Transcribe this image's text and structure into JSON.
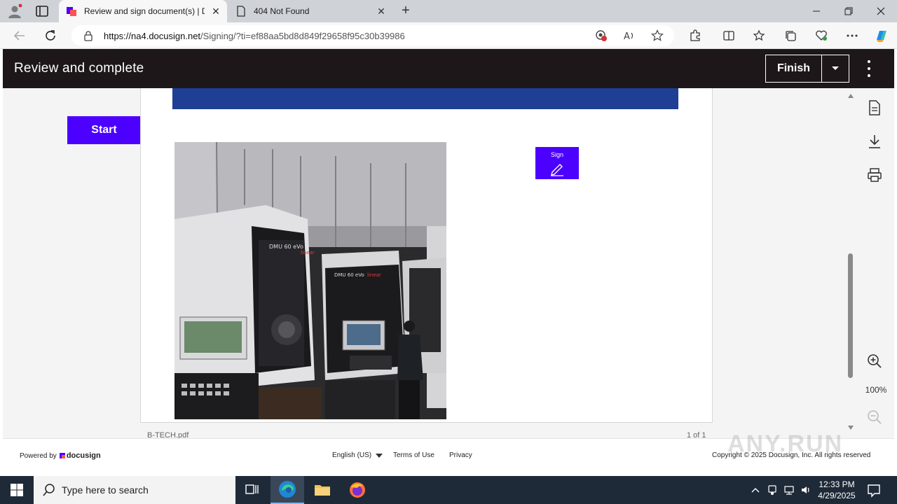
{
  "browser": {
    "tabs": [
      {
        "label": "Review and sign document(s) | D",
        "active": true,
        "icon": "docusign-favicon"
      },
      {
        "label": "404 Not Found",
        "active": false,
        "icon": "page-icon"
      }
    ],
    "new_tab_label": "+",
    "url_host": "https://na4.docusign.net",
    "url_path": "/Signing/?ti=ef88aa5bd8d849f29658f95c30b39986"
  },
  "header": {
    "title": "Review and complete",
    "finish_label": "Finish"
  },
  "document": {
    "start_label": "Start",
    "sign_label": "Sign",
    "filename": "B-TECH.pdf",
    "page_count": "1 of 1",
    "photo_labels": {
      "machine1": "DMU 60 eVo",
      "machine1_brand": "linear",
      "machine2": "DMU 60 eVo",
      "machine2_brand": "linear"
    }
  },
  "side_tools": {
    "zoom": "100%"
  },
  "footer": {
    "powered_by": "Powered by",
    "brand": "docusign",
    "language": "English (US)",
    "terms": "Terms of Use",
    "privacy": "Privacy",
    "copyright": "Copyright © 2025 Docusign, Inc. All rights reserved",
    "watermark": "ANY.RUN"
  },
  "taskbar": {
    "search_placeholder": "Type here to search",
    "time": "12:33 PM",
    "date": "4/29/2025"
  },
  "colors": {
    "accent": "#4c00ff",
    "header_bg": "#1d171a",
    "band_blue": "#1e3f94"
  }
}
